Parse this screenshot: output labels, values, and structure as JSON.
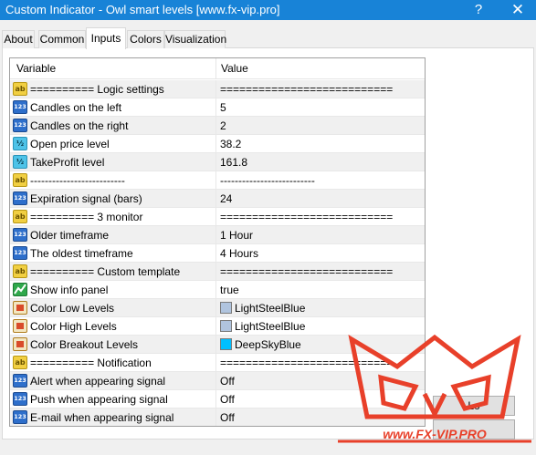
{
  "window": {
    "title": "Custom Indicator - Owl smart levels [www.fx-vip.pro]",
    "help_glyph": "?",
    "close_glyph": "✕"
  },
  "tabs": [
    {
      "label": "About",
      "active": false
    },
    {
      "label": "Common",
      "active": false
    },
    {
      "label": "Inputs",
      "active": true
    },
    {
      "label": "Colors",
      "active": false
    },
    {
      "label": "Visualization",
      "active": false
    }
  ],
  "grid": {
    "headers": {
      "variable": "Variable",
      "value": "Value"
    },
    "rows": [
      {
        "icon": "ab",
        "name": "========== Logic settings",
        "value": "==========================="
      },
      {
        "icon": "123",
        "name": "Candles on the left",
        "value": "5"
      },
      {
        "icon": "123",
        "name": "Candles on the right",
        "value": "2"
      },
      {
        "icon": "frac",
        "name": "Open price level",
        "value": "38.2"
      },
      {
        "icon": "frac",
        "name": "TakeProfit level",
        "value": "161.8"
      },
      {
        "icon": "ab",
        "name": "--------------------------",
        "value": "--------------------------"
      },
      {
        "icon": "123",
        "name": "Expiration signal (bars)",
        "value": "24"
      },
      {
        "icon": "ab",
        "name": "========== 3 monitor",
        "value": "==========================="
      },
      {
        "icon": "123",
        "name": "Older timeframe",
        "value": "1 Hour"
      },
      {
        "icon": "123",
        "name": "The oldest timeframe",
        "value": "4 Hours"
      },
      {
        "icon": "ab",
        "name": "========== Custom template",
        "value": "==========================="
      },
      {
        "icon": "bool",
        "name": "Show info panel",
        "value": "true"
      },
      {
        "icon": "color",
        "name": "Color Low Levels",
        "value": "LightSteelBlue",
        "swatch": "#b0c4de"
      },
      {
        "icon": "color",
        "name": "Color High Levels",
        "value": "LightSteelBlue",
        "swatch": "#b0c4de"
      },
      {
        "icon": "color",
        "name": "Color Breakout Levels",
        "value": "DeepSkyBlue",
        "swatch": "#00bfff"
      },
      {
        "icon": "ab",
        "name": "========== Notification",
        "value": "==========================="
      },
      {
        "icon": "123",
        "name": "Alert when appearing signal",
        "value": "Off"
      },
      {
        "icon": "123",
        "name": "Push when appearing signal",
        "value": "Off"
      },
      {
        "icon": "123",
        "name": "E-mail when appearing signal",
        "value": "Off"
      }
    ]
  },
  "buttons": {
    "load": "Lo",
    "save": ""
  },
  "watermark": {
    "text": "www.FX-VIP.PRO",
    "icon": "owl-logo"
  },
  "colors": {
    "titlebar": "#1883d7",
    "accent": "#e8402a"
  }
}
